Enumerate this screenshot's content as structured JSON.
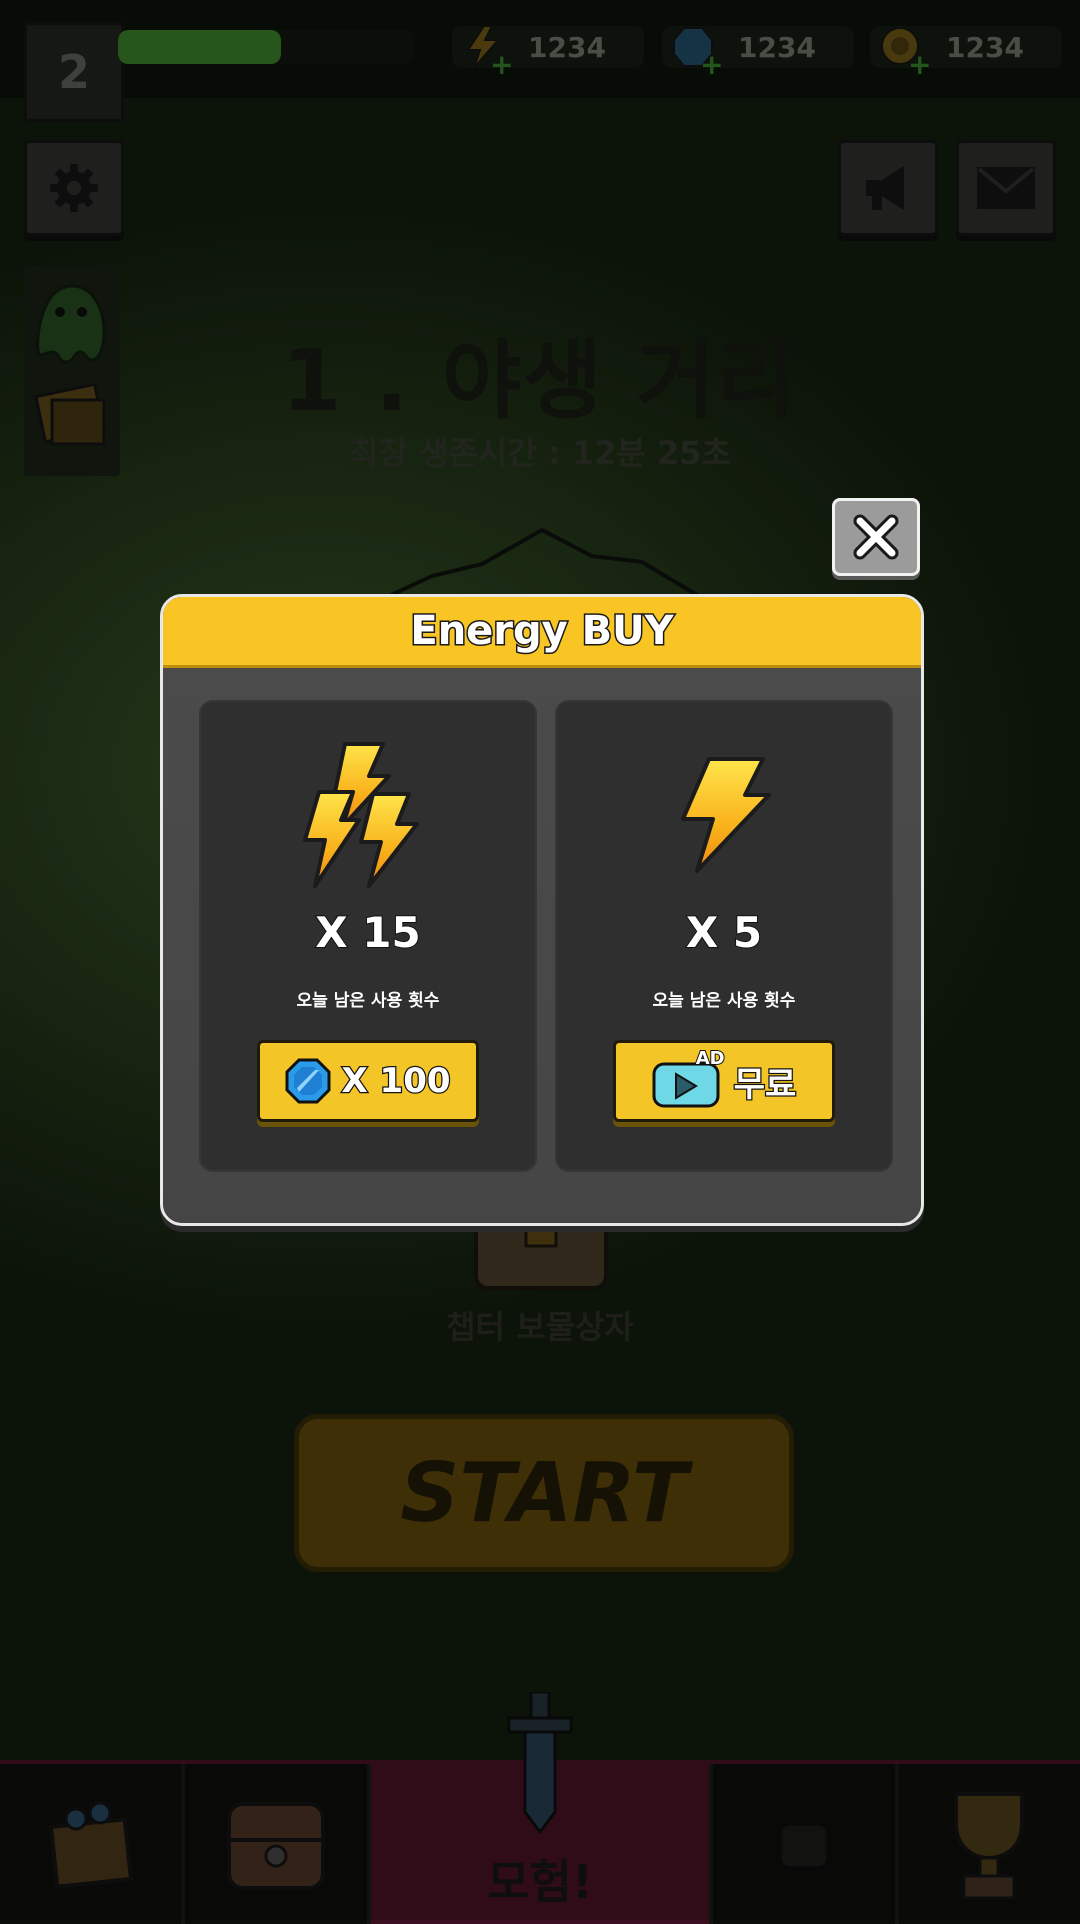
{
  "topbar": {
    "level": "2",
    "xp_progress": 0.55,
    "currencies": [
      {
        "name": "energy",
        "icon": "lightning-icon",
        "value": "1234"
      },
      {
        "name": "gem",
        "icon": "gem-icon",
        "value": "1234"
      },
      {
        "name": "coin",
        "icon": "coin-icon",
        "value": "1234"
      }
    ]
  },
  "stage": {
    "title": "1 . 야생 거리",
    "best_time": "최장 생존시간 : 12분 25초",
    "chest_label": "챕터 보물상자",
    "start_label": "START"
  },
  "bottom_nav": {
    "active_label": "모험!"
  },
  "modal": {
    "title": "Energy BUY",
    "options": [
      {
        "quantity": "X 15",
        "remaining": "오늘 남은 사용 횟수",
        "button_icon": "gem-icon",
        "button_label": "X 100"
      },
      {
        "quantity": "X 5",
        "remaining": "오늘 남은 사용 횟수",
        "button_icon": "ad-video-icon",
        "button_badge": "AD",
        "button_label": "무료"
      }
    ]
  },
  "colors": {
    "header_yellow": "#f8c525",
    "button_yellow": "#f3c527",
    "bolt_orange": "#f7a318",
    "gem_blue": "#2a9be8",
    "nav_active": "#3b0f1f"
  }
}
